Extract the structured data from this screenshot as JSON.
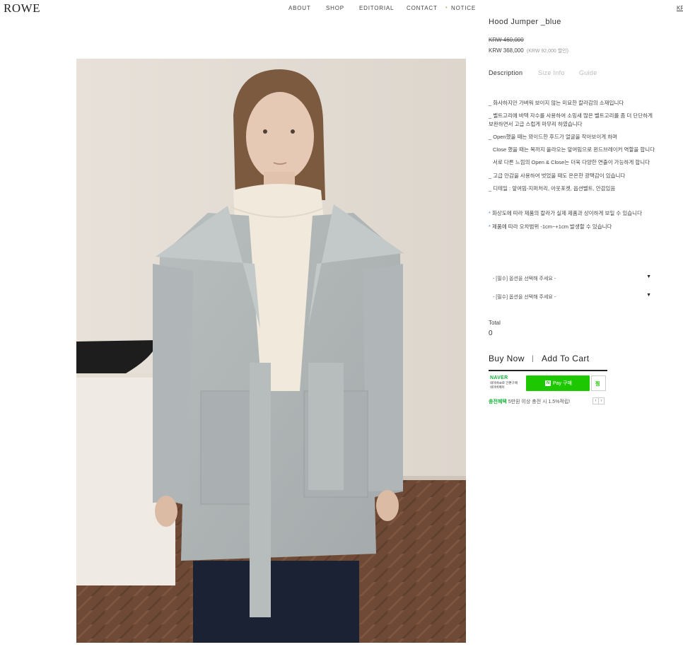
{
  "header": {
    "logo": "ROWE",
    "nav": [
      "ABOUT",
      "SHOP",
      "EDITORIAL",
      "CONTACT",
      "NOTICE"
    ],
    "lang": "KR"
  },
  "product": {
    "title": "Hood Jumper _blue",
    "price_original": "KRW 460,000",
    "price_sale": "KRW 368,000",
    "discount": "(KRW 92,000 할인)"
  },
  "tabs": [
    "Description",
    "Size Info",
    "Guide"
  ],
  "description": [
    "_ 화사하지만 가벼워 보이지 않는 미묘한 칼라감의 소재입니다",
    "_ 벨트고리에 바텍 자수를 사용하여 소밍새 많은 벨트고리를 좀 더 단단하게",
    "보완하면서 고급 스럽게 마무리 하였습니다",
    "_ Open했을 때는 와이드한 후드가 얼굴을 작아보이게 하며",
    "Close 했을 때는 목까지 올라오는 앞여밈으로 윈드브레이커 역할을 합니다",
    "서로 다른 느낌의 Open & Close는 더욱 다양한 연출이 가능하게 합니다",
    "_ 고급 안감을 사용하여 벗었을 때도 은은한 광택감이 있습니다",
    "_ 디테일 : 앞여밈-지퍼처리, 아웃포켓, 옵션벨트, 안감있음"
  ],
  "notes": [
    "화상도에 따라 제품의 칼라가 실제 제품과 상이하게 보일 수 있습니다",
    "제품에 따라 오차범위 -1cm~+1cm 발생할 수 있습니다"
  ],
  "notes_marker": "*",
  "options": [
    "- [필수] 옵션을 선택해 주세요 -",
    "- [필수] 옵션을 선택해 주세요 -"
  ],
  "option_arrow": "▼",
  "total": {
    "label": "Total",
    "value": "0"
  },
  "actions": {
    "buy": "Buy Now",
    "separator": "|",
    "cart": "Add To Cart"
  },
  "npay": {
    "brand": "NAVER",
    "sub1": "네이버ID로 간편구매",
    "sub2": "네이버페이",
    "button_label": "Pay 구매",
    "n_mark": "N",
    "zzim": "찜"
  },
  "promo": {
    "highlight": "충전혜택",
    "text": " 5만원 이상 충전 시 1.5%적립!",
    "prev": "‹",
    "next": "›"
  },
  "colors": {
    "naver_green": "#1ec800",
    "notice_dot": "#c8b25e",
    "note_asterisk": "#5a7fcf"
  }
}
